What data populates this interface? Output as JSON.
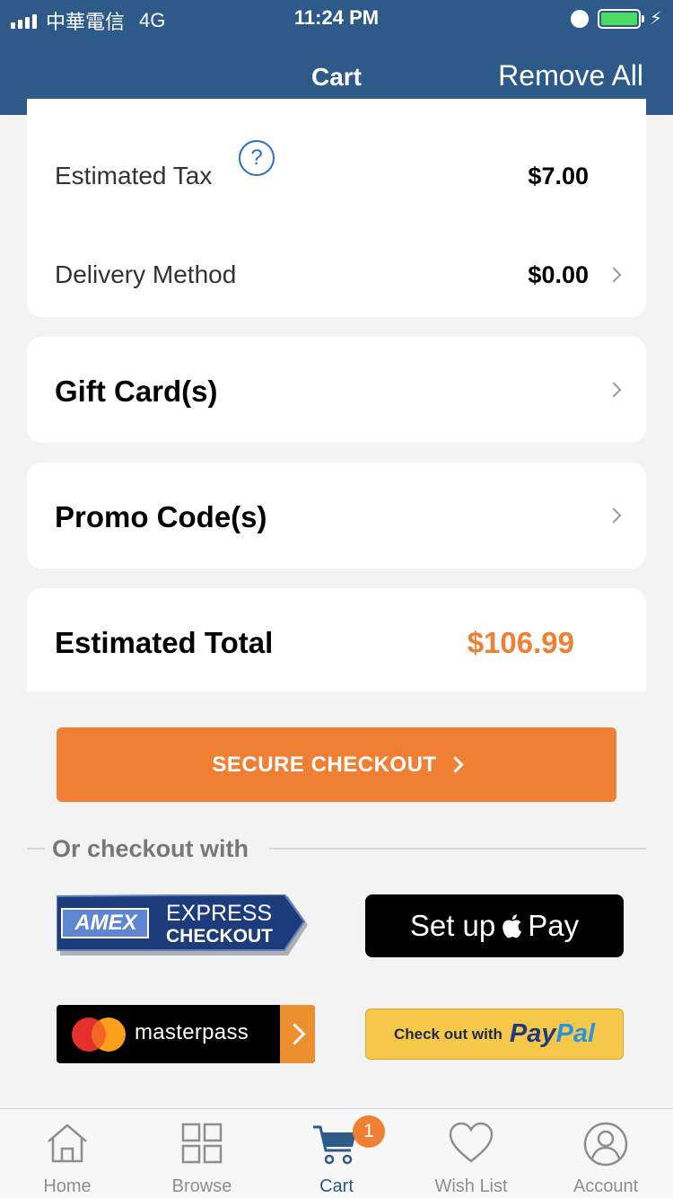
{
  "status_bar": {
    "carrier": "中華電信",
    "network": "4G",
    "time": "11:24 PM"
  },
  "nav": {
    "title": "Cart",
    "remove_all": "Remove All"
  },
  "summary": {
    "estimated_tax_label": "Estimated Tax",
    "help_symbol": "?",
    "estimated_tax_value": "$7.00",
    "delivery_label": "Delivery Method",
    "delivery_value": "$0.00"
  },
  "gift_card_label": "Gift Card(s)",
  "promo_code_label": "Promo Code(s)",
  "total": {
    "label": "Estimated Total",
    "value": "$106.99"
  },
  "secure_checkout_label": "SECURE CHECKOUT",
  "or_checkout_with": "Or checkout with",
  "payments": {
    "amex_brand": "AMEX",
    "amex_line1": "EXPRESS",
    "amex_line2": "CHECKOUT",
    "apple_pay_prefix": "Set up",
    "apple_pay_suffix": "Pay",
    "masterpass": "masterpass",
    "paypal_prefix": "Check out with",
    "paypal_part1": "Pay",
    "paypal_part2": "Pal"
  },
  "tabs": [
    {
      "label": "Home",
      "icon": "home-icon"
    },
    {
      "label": "Browse",
      "icon": "grid-icon"
    },
    {
      "label": "Cart",
      "icon": "cart-icon",
      "active": true
    },
    {
      "label": "Wish List",
      "icon": "heart-icon"
    },
    {
      "label": "Account",
      "icon": "account-icon"
    }
  ],
  "cart_badge": "1",
  "colors": {
    "header": "#2d5a89",
    "accent": "#ef7f32",
    "link_blue": "#2f6bc7"
  }
}
